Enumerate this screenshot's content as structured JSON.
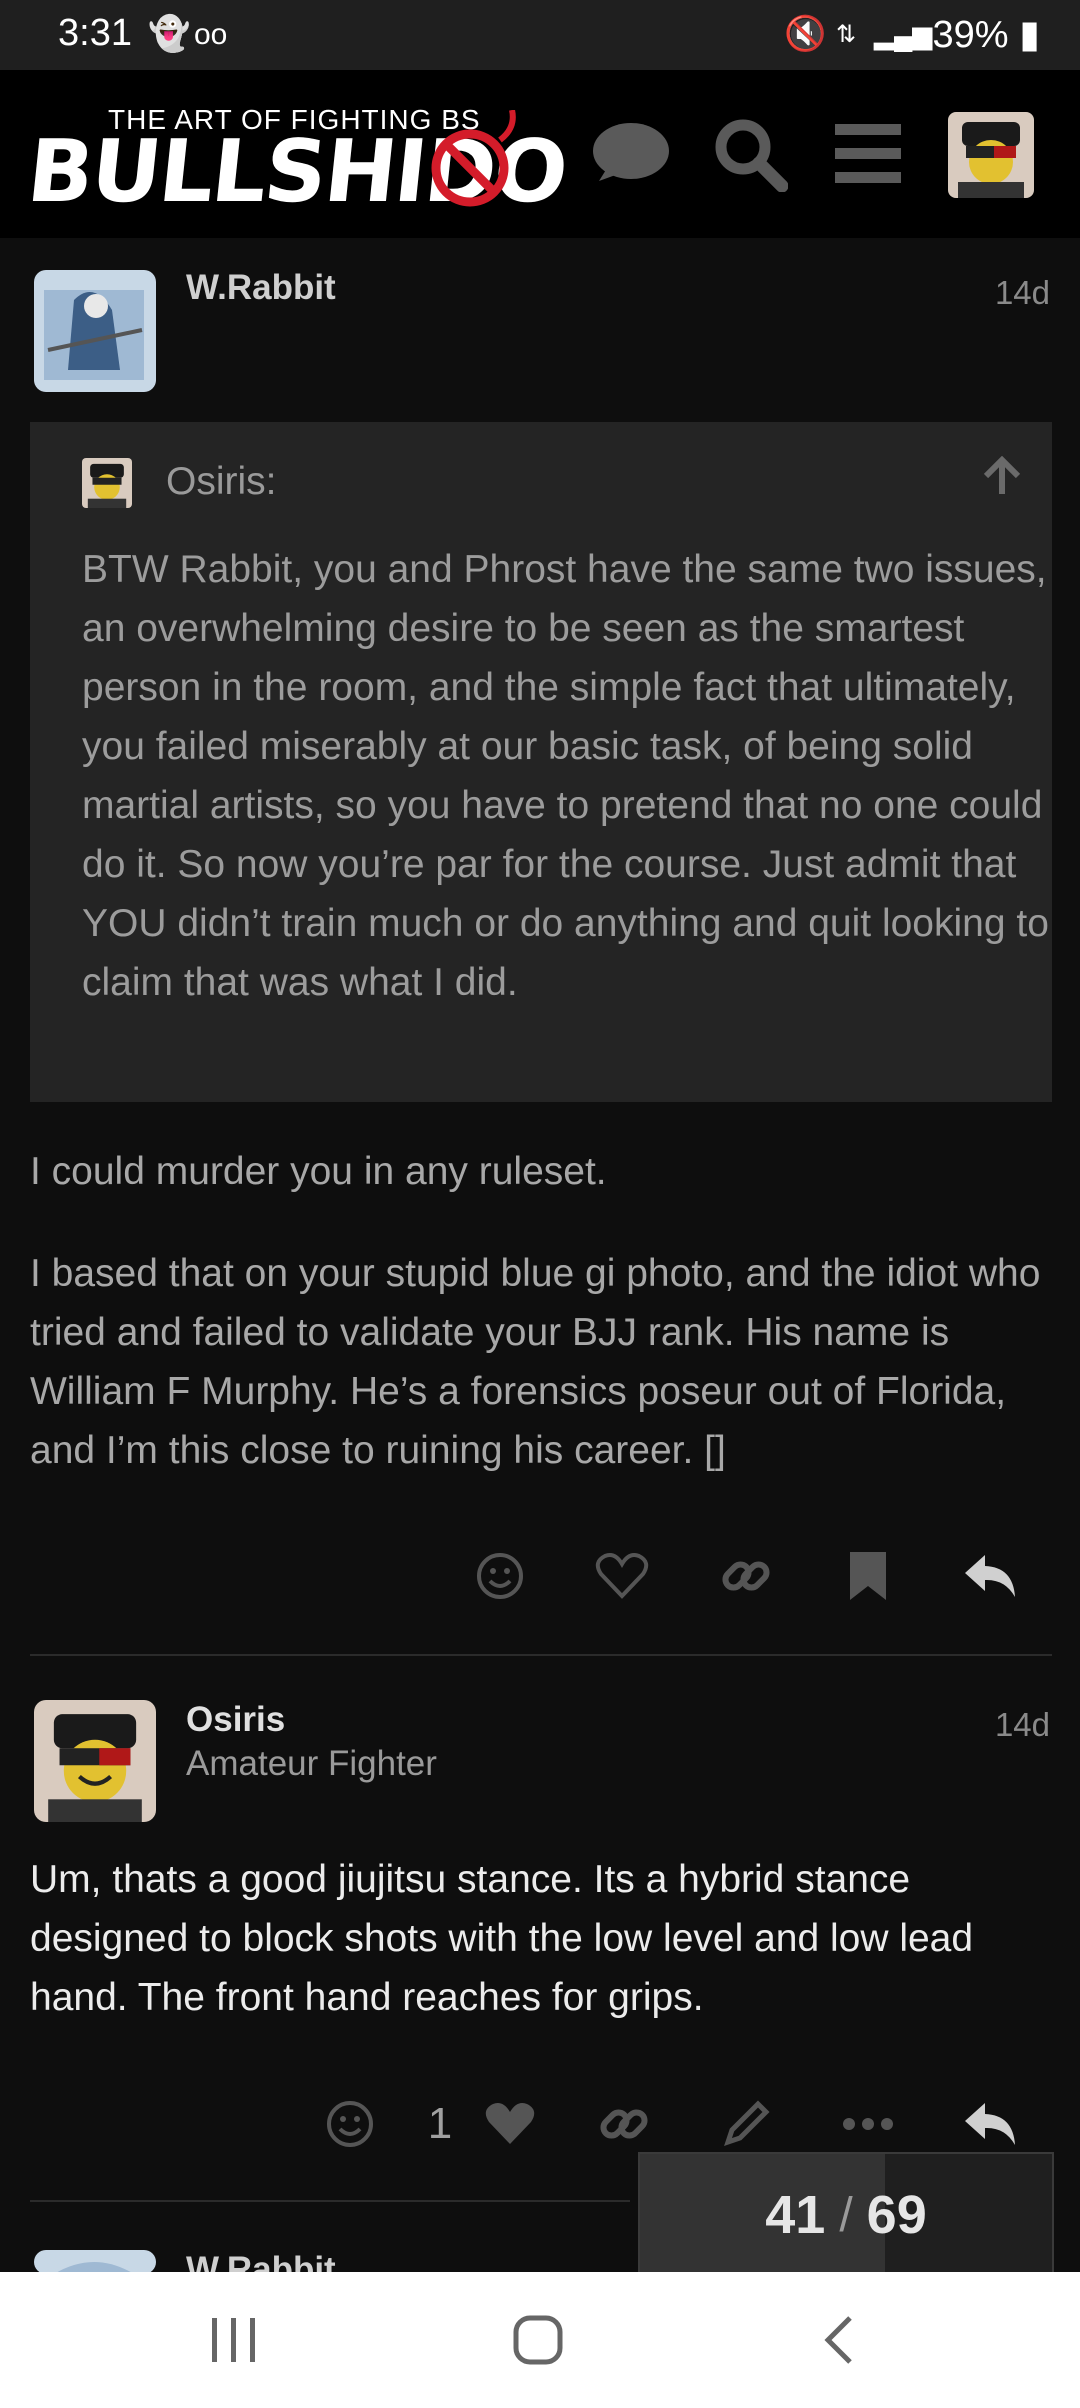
{
  "status_bar": {
    "time": "3:31",
    "battery": "39%"
  },
  "header": {
    "logo_top": "THE ART OF FIGHTING BS",
    "logo_main": "BULLSHIDO"
  },
  "posts": [
    {
      "username": "W.Rabbit",
      "age": "14d",
      "quote": {
        "author": "Osiris:",
        "text": "BTW Rabbit, you and Phrost have the same two issues, an overwhelming desire to be seen as the smartest person in the room, and the simple fact that ultimately, you failed miserably at our basic task, of being solid martial artists, so you have to pretend that no one could do it. So now you’re par for the course. Just admit that YOU didn’t train much or do anything and quit looking to claim that was what I did."
      },
      "paragraphs": [
        "I could murder you in any ruleset.",
        "I based that on your stupid blue gi photo, and the idiot who tried and failed to validate your BJJ rank. His name is William F Murphy. He’s a forensics poseur out of Florida, and I’m this close to ruining his career. []"
      ]
    },
    {
      "username": "Osiris",
      "user_title": "Amateur Fighter",
      "age": "14d",
      "paragraphs": [
        "Um, thats a good jiujitsu stance. Its a hybrid stance designed to block shots with the low level and low lead hand. The front hand reaches for grips."
      ],
      "like_count": "1"
    },
    {
      "username": "W.Rabbit"
    }
  ],
  "progress": {
    "current": "41",
    "separator": "/",
    "total": "69",
    "fraction": 0.594
  },
  "colors": {
    "background": "#0e0e0e",
    "quote_bg": "#242424",
    "icon": "#7a7a7a"
  }
}
